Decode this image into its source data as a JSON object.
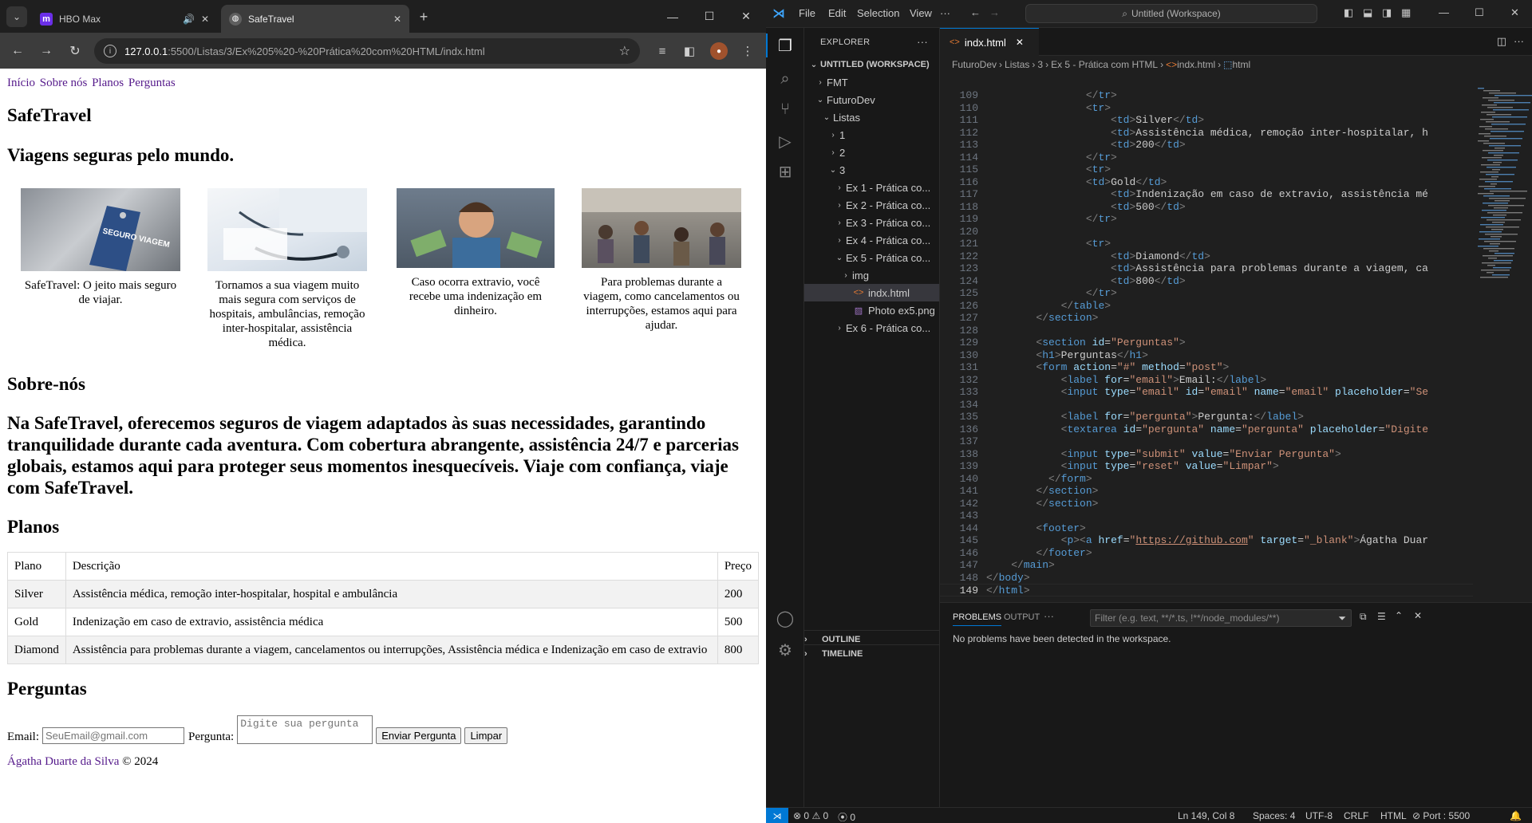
{
  "browser": {
    "tabs": [
      {
        "title": "HBO Max",
        "favicon": "m",
        "favicon_color": "#6b2fe8",
        "icon": "speaker-icon"
      },
      {
        "title": "SafeTravel",
        "favicon": "globe-icon",
        "favicon_color": "#6f6f6f",
        "active": true
      }
    ],
    "url_host": "127.0.0.1",
    "url_path": ":5500/Listas/3/Ex%205%20-%20Prática%20com%20HTML/indx.html"
  },
  "site": {
    "nav": [
      "Início",
      "Sobre nós",
      "Planos",
      "Perguntas"
    ],
    "title": "SafeTravel",
    "tagline": "Viagens seguras pelo mundo.",
    "cards": [
      {
        "caption": "SafeTravel: O jeito mais seguro de viajar.",
        "tag": "SEGURO VIAGEM"
      },
      {
        "caption": "Tornamos a sua viagem muito mais segura com serviços de hospitais, ambulâncias, remoção inter-hospitalar, assistência médica."
      },
      {
        "caption": "Caso ocorra extravio, você recebe uma indenização em dinheiro."
      },
      {
        "caption": "Para problemas durante a viagem, como cancelamentos ou interrupções, estamos aqui para ajudar."
      }
    ],
    "about_heading": "Sobre-nós",
    "about_text": "Na SafeTravel, oferecemos seguros de viagem adaptados às suas necessidades, garantindo tranquilidade durante cada aventura. Com cobertura abrangente, assistência 24/7 e parcerias globais, estamos aqui para proteger seus momentos inesquecíveis. Viaje com confiança, viaje com SafeTravel.",
    "plans_heading": "Planos",
    "plans_table": {
      "headers": [
        "Plano",
        "Descrição",
        "Preço"
      ],
      "rows": [
        [
          "Silver",
          "Assistência médica, remoção inter-hospitalar, hospital e ambulância",
          "200"
        ],
        [
          "Gold",
          "Indenização em caso de extravio, assistência médica",
          "500"
        ],
        [
          "Diamond",
          "Assistência para problemas durante a viagem, cancelamentos ou interrupções, Assistência médica e Indenização em caso de extravio",
          "800"
        ]
      ]
    },
    "questions_heading": "Perguntas",
    "form": {
      "email_label": "Email:",
      "email_placeholder": "SeuEmail@gmail.com",
      "question_label": "Pergunta:",
      "question_placeholder": "Digite sua pergunta",
      "submit_label": "Enviar Pergunta",
      "reset_label": "Limpar"
    },
    "footer_link": "Ágatha Duarte da Silva",
    "footer_suffix": " © 2024"
  },
  "vscode": {
    "menu": [
      "File",
      "Edit",
      "Selection",
      "View",
      "···"
    ],
    "search": "Untitled (Workspace)",
    "explorer_title": "EXPLORER",
    "tree": [
      {
        "label": "UNTITLED (WORKSPACE)",
        "depth": 0,
        "chev": "v",
        "bold": true
      },
      {
        "label": "FMT",
        "depth": 1,
        "chev": ">"
      },
      {
        "label": "FuturoDev",
        "depth": 1,
        "chev": "v"
      },
      {
        "label": "Listas",
        "depth": 2,
        "chev": "v"
      },
      {
        "label": "1",
        "depth": 3,
        "chev": ">"
      },
      {
        "label": "2",
        "depth": 3,
        "chev": ">"
      },
      {
        "label": "3",
        "depth": 3,
        "chev": "v"
      },
      {
        "label": "Ex 1 - Prática co...",
        "depth": 4,
        "chev": ">"
      },
      {
        "label": "Ex 2 - Prática co...",
        "depth": 4,
        "chev": ">"
      },
      {
        "label": "Ex 3 - Prática co...",
        "depth": 4,
        "chev": ">"
      },
      {
        "label": "Ex 4 - Prática co...",
        "depth": 4,
        "chev": ">"
      },
      {
        "label": "Ex 5 - Prática co...",
        "depth": 4,
        "chev": "v"
      },
      {
        "label": "img",
        "depth": 5,
        "chev": ">"
      },
      {
        "label": "indx.html",
        "depth": 5,
        "chev": "",
        "icon": "html",
        "selected": true
      },
      {
        "label": "Photo ex5.png",
        "depth": 5,
        "chev": "",
        "icon": "image"
      },
      {
        "label": "Ex 6 - Prática co...",
        "depth": 4,
        "chev": ">"
      }
    ],
    "outline": "OUTLINE",
    "timeline": "TIMELINE",
    "editor_tab": "indx.html",
    "breadcrumbs": [
      "FuturoDev",
      "Listas",
      "3",
      "Ex 5 - Prática com HTML",
      "indx.html",
      "html"
    ],
    "code_lines": [
      {
        "n": "109",
        "html": "                <span class=\"tg\">&lt;/</span><span class=\"t\">tr</span><span class=\"tg\">&gt;</span>"
      },
      {
        "n": "110",
        "html": "                <span class=\"tg\">&lt;</span><span class=\"t\">tr</span><span class=\"tg\">&gt;</span>"
      },
      {
        "n": "111",
        "html": "                    <span class=\"tg\">&lt;</span><span class=\"t\">td</span><span class=\"tg\">&gt;</span>Silver<span class=\"tg\">&lt;/</span><span class=\"t\">td</span><span class=\"tg\">&gt;</span>"
      },
      {
        "n": "112",
        "html": "                    <span class=\"tg\">&lt;</span><span class=\"t\">td</span><span class=\"tg\">&gt;</span>Assistência médica, remoção inter-hospitalar, h"
      },
      {
        "n": "113",
        "html": "                    <span class=\"tg\">&lt;</span><span class=\"t\">td</span><span class=\"tg\">&gt;</span>200<span class=\"tg\">&lt;/</span><span class=\"t\">td</span><span class=\"tg\">&gt;</span>"
      },
      {
        "n": "114",
        "html": "                <span class=\"tg\">&lt;/</span><span class=\"t\">tr</span><span class=\"tg\">&gt;</span>"
      },
      {
        "n": "115",
        "html": "                <span class=\"tg\">&lt;</span><span class=\"t\">tr</span><span class=\"tg\">&gt;</span>"
      },
      {
        "n": "116",
        "html": "                <span class=\"tg\">&lt;</span><span class=\"t\">td</span><span class=\"tg\">&gt;</span>Gold<span class=\"tg\">&lt;/</span><span class=\"t\">td</span><span class=\"tg\">&gt;</span>"
      },
      {
        "n": "117",
        "html": "                    <span class=\"tg\">&lt;</span><span class=\"t\">td</span><span class=\"tg\">&gt;</span>Indenização em caso de extravio, assistência mé"
      },
      {
        "n": "118",
        "html": "                    <span class=\"tg\">&lt;</span><span class=\"t\">td</span><span class=\"tg\">&gt;</span>500<span class=\"tg\">&lt;/</span><span class=\"t\">td</span><span class=\"tg\">&gt;</span>"
      },
      {
        "n": "119",
        "html": "                <span class=\"tg\">&lt;/</span><span class=\"t\">tr</span><span class=\"tg\">&gt;</span>"
      },
      {
        "n": "120",
        "html": ""
      },
      {
        "n": "121",
        "html": "                <span class=\"tg\">&lt;</span><span class=\"t\">tr</span><span class=\"tg\">&gt;</span>"
      },
      {
        "n": "122",
        "html": "                    <span class=\"tg\">&lt;</span><span class=\"t\">td</span><span class=\"tg\">&gt;</span>Diamond<span class=\"tg\">&lt;/</span><span class=\"t\">td</span><span class=\"tg\">&gt;</span>"
      },
      {
        "n": "123",
        "html": "                    <span class=\"tg\">&lt;</span><span class=\"t\">td</span><span class=\"tg\">&gt;</span>Assistência para problemas durante a viagem, ca"
      },
      {
        "n": "124",
        "html": "                    <span class=\"tg\">&lt;</span><span class=\"t\">td</span><span class=\"tg\">&gt;</span>800<span class=\"tg\">&lt;/</span><span class=\"t\">td</span><span class=\"tg\">&gt;</span>"
      },
      {
        "n": "125",
        "html": "                <span class=\"tg\">&lt;/</span><span class=\"t\">tr</span><span class=\"tg\">&gt;</span>"
      },
      {
        "n": "126",
        "html": "            <span class=\"tg\">&lt;/</span><span class=\"t\">table</span><span class=\"tg\">&gt;</span>"
      },
      {
        "n": "127",
        "html": "        <span class=\"tg\">&lt;/</span><span class=\"t\">section</span><span class=\"tg\">&gt;</span>"
      },
      {
        "n": "128",
        "html": ""
      },
      {
        "n": "129",
        "html": "        <span class=\"tg\">&lt;</span><span class=\"t\">section</span> <span class=\"a\">id</span>=<span class=\"s\">\"Perguntas\"</span><span class=\"tg\">&gt;</span>"
      },
      {
        "n": "130",
        "html": "        <span class=\"tg\">&lt;</span><span class=\"t\">h1</span><span class=\"tg\">&gt;</span>Perguntas<span class=\"tg\">&lt;/</span><span class=\"t\">h1</span><span class=\"tg\">&gt;</span>"
      },
      {
        "n": "131",
        "html": "        <span class=\"tg\">&lt;</span><span class=\"t\">form</span> <span class=\"a\">action</span>=<span class=\"s\">\"#\"</span> <span class=\"a\">method</span>=<span class=\"s\">\"post\"</span><span class=\"tg\">&gt;</span>"
      },
      {
        "n": "132",
        "html": "            <span class=\"tg\">&lt;</span><span class=\"t\">label</span> <span class=\"a\">for</span>=<span class=\"s\">\"email\"</span><span class=\"tg\">&gt;</span>Email:<span class=\"tg\">&lt;/</span><span class=\"t\">label</span><span class=\"tg\">&gt;</span>"
      },
      {
        "n": "133",
        "html": "            <span class=\"tg\">&lt;</span><span class=\"t\">input</span> <span class=\"a\">type</span>=<span class=\"s\">\"email\"</span> <span class=\"a\">id</span>=<span class=\"s\">\"email\"</span> <span class=\"a\">name</span>=<span class=\"s\">\"email\"</span> <span class=\"a\">placeholder</span>=<span class=\"s\">\"Se</span>"
      },
      {
        "n": "134",
        "html": ""
      },
      {
        "n": "135",
        "html": "            <span class=\"tg\">&lt;</span><span class=\"t\">label</span> <span class=\"a\">for</span>=<span class=\"s\">\"pergunta\"</span><span class=\"tg\">&gt;</span>Pergunta:<span class=\"tg\">&lt;/</span><span class=\"t\">label</span><span class=\"tg\">&gt;</span>"
      },
      {
        "n": "136",
        "html": "            <span class=\"tg\">&lt;</span><span class=\"t\">textarea</span> <span class=\"a\">id</span>=<span class=\"s\">\"pergunta\"</span> <span class=\"a\">name</span>=<span class=\"s\">\"pergunta\"</span> <span class=\"a\">placeholder</span>=<span class=\"s\">\"Digite</span>"
      },
      {
        "n": "137",
        "html": ""
      },
      {
        "n": "138",
        "html": "            <span class=\"tg\">&lt;</span><span class=\"t\">input</span> <span class=\"a\">type</span>=<span class=\"s\">\"submit\"</span> <span class=\"a\">value</span>=<span class=\"s\">\"Enviar Pergunta\"</span><span class=\"tg\">&gt;</span>"
      },
      {
        "n": "139",
        "html": "            <span class=\"tg\">&lt;</span><span class=\"t\">input</span> <span class=\"a\">type</span>=<span class=\"s\">\"reset\"</span> <span class=\"a\">value</span>=<span class=\"s\">\"Limpar\"</span><span class=\"tg\">&gt;</span>"
      },
      {
        "n": "140",
        "html": "          <span class=\"tg\">&lt;/</span><span class=\"t\">form</span><span class=\"tg\">&gt;</span>"
      },
      {
        "n": "141",
        "html": "        <span class=\"tg\">&lt;/</span><span class=\"t\">section</span><span class=\"tg\">&gt;</span>"
      },
      {
        "n": "142",
        "html": "        <span class=\"tg\">&lt;/</span><span class=\"t\">section</span><span class=\"tg\">&gt;</span>"
      },
      {
        "n": "143",
        "html": ""
      },
      {
        "n": "144",
        "html": "        <span class=\"tg\">&lt;</span><span class=\"t\">footer</span><span class=\"tg\">&gt;</span>"
      },
      {
        "n": "145",
        "html": "            <span class=\"tg\">&lt;</span><span class=\"t\">p</span><span class=\"tg\">&gt;&lt;</span><span class=\"t\">a</span> <span class=\"a\">href</span>=<span class=\"s\">\"</span><span class=\"u\">https://github.com</span><span class=\"s\">\"</span> <span class=\"a\">target</span>=<span class=\"s\">\"_blank\"</span><span class=\"tg\">&gt;</span>Ágatha Duar"
      },
      {
        "n": "146",
        "html": "        <span class=\"tg\">&lt;/</span><span class=\"t\">footer</span><span class=\"tg\">&gt;</span>"
      },
      {
        "n": "147",
        "html": "    <span class=\"tg\">&lt;/</span><span class=\"t\">main</span><span class=\"tg\">&gt;</span>"
      },
      {
        "n": "148",
        "html": "<span class=\"tg\">&lt;/</span><span class=\"t\">body</span><span class=\"tg\">&gt;</span>"
      },
      {
        "n": "149",
        "html": "<span class=\"tg\">&lt;/</span><span class=\"t\">html</span><span class=\"tg\">&gt;</span>",
        "current": true
      }
    ],
    "panel_tabs": [
      "PROBLEMS",
      "OUTPUT",
      "···"
    ],
    "panel_filter": "Filter (e.g. text, **/*.ts, !**/node_modules/**)",
    "panel_message": "No problems have been detected in the workspace.",
    "status": {
      "errors": "0",
      "warnings": "0",
      "ports": "0",
      "position": "Ln 149, Col 8",
      "spaces": "Spaces: 4",
      "encoding": "UTF-8",
      "eol": "CRLF",
      "language": "HTML",
      "port": "Port : 5500"
    },
    "accent": "#0078d4"
  }
}
